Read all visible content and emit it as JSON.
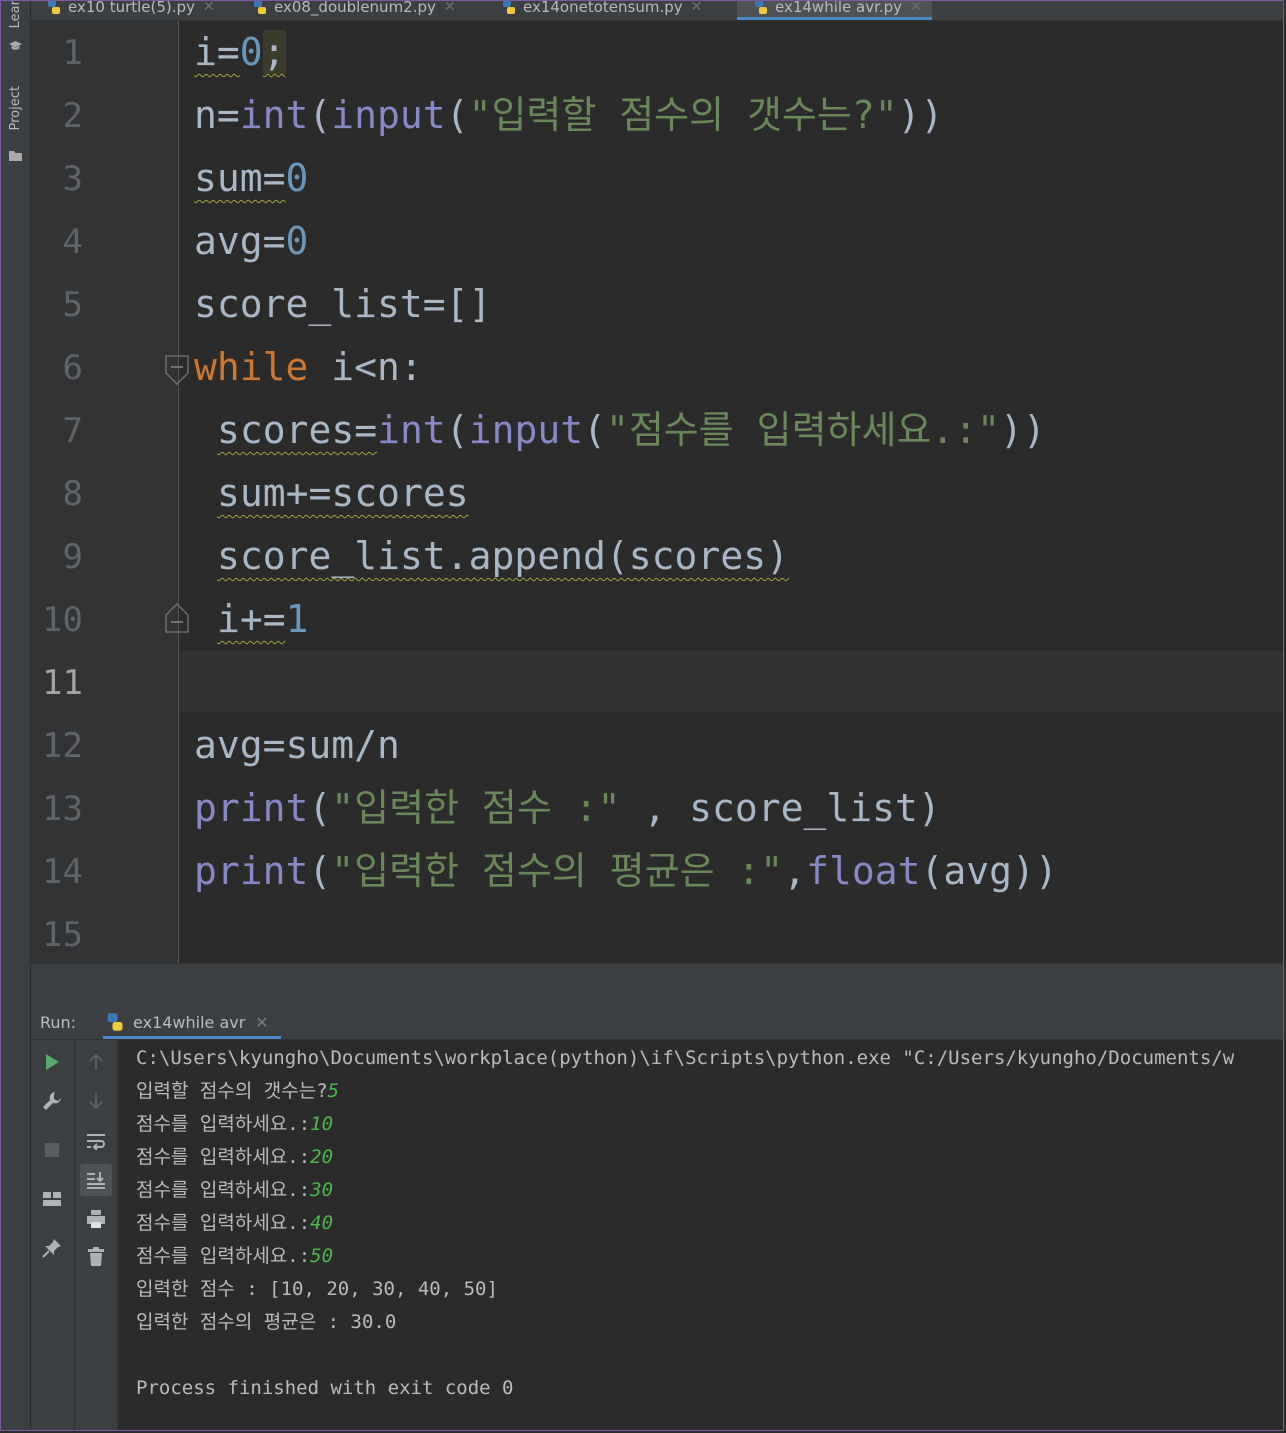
{
  "sidebar": {
    "learn_label": "Lear",
    "project_label": "Project"
  },
  "tabs": [
    {
      "label": "ex10 turtle(5).py",
      "active": false
    },
    {
      "label": "ex08_doublenum2.py",
      "active": false
    },
    {
      "label": "ex14onetotensum.py",
      "active": false
    },
    {
      "label": "ex14while avr.py",
      "active": true
    }
  ],
  "editor": {
    "line_numbers": [
      "1",
      "2",
      "3",
      "4",
      "5",
      "6",
      "7",
      "8",
      "9",
      "10",
      "11",
      "12",
      "13",
      "14",
      "15"
    ],
    "current_line": "11",
    "code": {
      "l1_a": "i=",
      "l1_b": "0",
      "l1_c": ";",
      "l2_a": "n=",
      "l2_b": "int",
      "l2_c": "(",
      "l2_d": "input",
      "l2_e": "(",
      "l2_f": "\"입력할 점수의 갯수는?\"",
      "l2_g": "))",
      "l3_a": "sum=",
      "l3_b": "0",
      "l4_a": "avg=",
      "l4_b": "0",
      "l5": "score_list=[]",
      "l6_a": "while",
      "l6_b": " i<n:",
      "l7_a": "scores=",
      "l7_b": "int",
      "l7_c": "(",
      "l7_d": "input",
      "l7_e": "(",
      "l7_f": "\"점수를 입력하세요.:\"",
      "l7_g": "))",
      "l8": "sum+=scores",
      "l9": "score_list.append(scores)",
      "l10_a": "i+=",
      "l10_b": "1",
      "l12": "avg=sum/n",
      "l13_a": "print",
      "l13_b": "(",
      "l13_c": "\"입력한 점수 :\"",
      "l13_d": " , score_list)",
      "l14_a": "print",
      "l14_b": "(",
      "l14_c": "\"입력한 점수의 평균은 :\"",
      "l14_d": ",",
      "l14_e": "float",
      "l14_f": "(avg))"
    }
  },
  "run": {
    "label": "Run:",
    "tab_label": "ex14while avr",
    "console": {
      "cmd": "C:\\Users\\kyungho\\Documents\\workplace(python)\\if\\Scripts\\python.exe \"C:/Users/kyungho/Documents/w",
      "prompt_count": "입력할 점수의 갯수는?",
      "input_count": "5",
      "prompt_score": "점수를 입력하세요.:",
      "inputs": [
        "10",
        "20",
        "30",
        "40",
        "50"
      ],
      "result_list": "입력한 점수 : [10, 20, 30, 40, 50]",
      "result_avg": "입력한 점수의 평균은 : 30.0",
      "exit": "Process finished with exit code 0"
    }
  },
  "colors": {
    "keyword": "#cc7832",
    "number": "#6897bb",
    "string": "#6a8759",
    "builtin": "#8888c6",
    "user_input": "#4cb848"
  }
}
